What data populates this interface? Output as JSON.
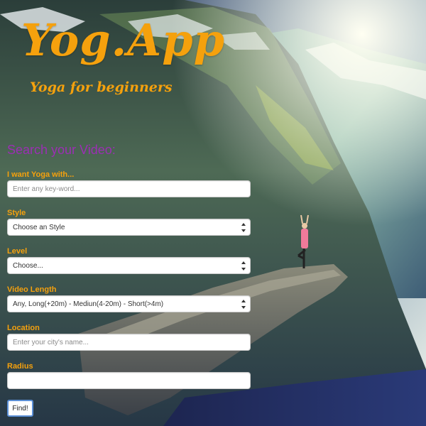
{
  "brand": {
    "title": "Yog.App",
    "subtitle": "Yoga for beginners"
  },
  "search": {
    "heading": "Search your Video:",
    "keyword": {
      "label": "I want Yoga with...",
      "placeholder": "Enter any key-word..."
    },
    "style": {
      "label": "Style",
      "selected": "Choose an Style"
    },
    "level": {
      "label": "Level",
      "selected": "Choose..."
    },
    "video_length": {
      "label": "Video Length",
      "selected": "Any, Long(+20m) - Mediun(4-20m) - Short(>4m)"
    },
    "location": {
      "label": "Location",
      "placeholder": "Enter your city's name..."
    },
    "radius": {
      "label": "Radius",
      "value": ""
    },
    "submit_label": "Find!"
  },
  "colors": {
    "brand_accent": "#f5a10d",
    "heading": "#9b2fb3",
    "button_border": "#5b8fd6"
  },
  "icons": {
    "select_arrows": "select-updown-icon"
  }
}
